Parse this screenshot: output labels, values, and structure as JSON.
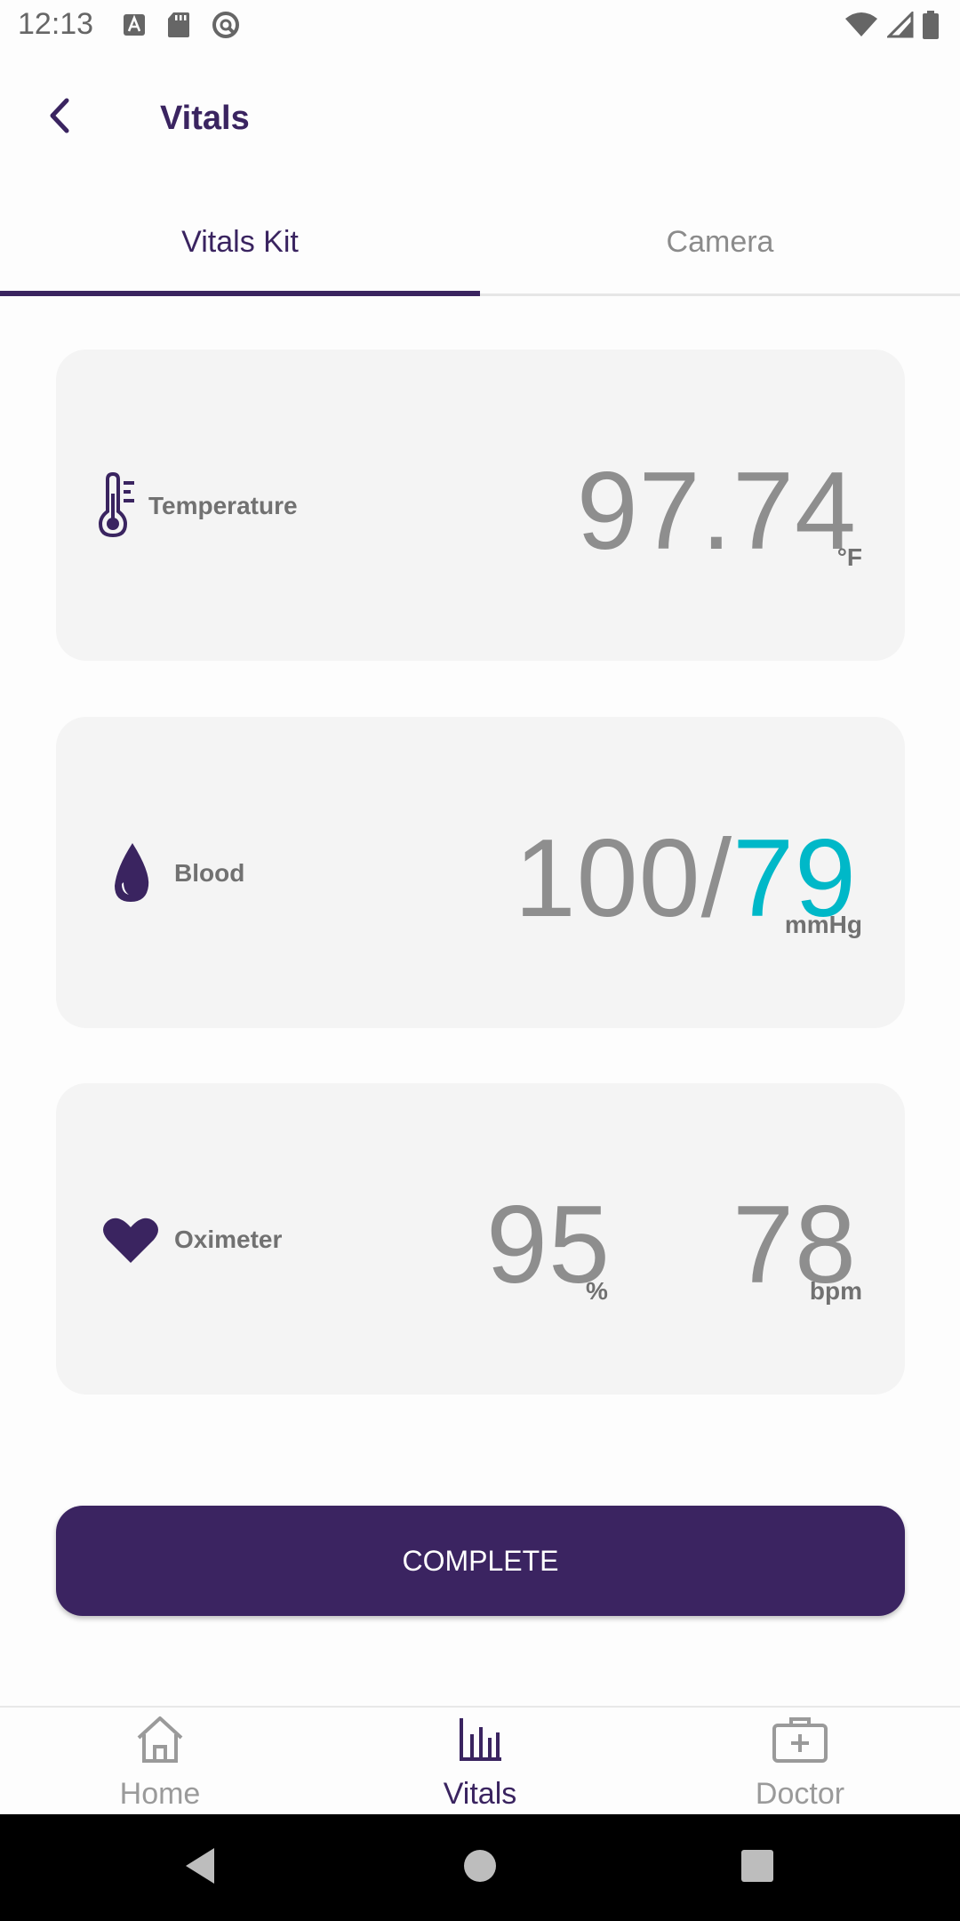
{
  "status_bar": {
    "time": "12:13"
  },
  "app_bar": {
    "title": "Vitals"
  },
  "tabs": [
    {
      "label": "Vitals Kit",
      "selected": true
    },
    {
      "label": "Camera",
      "selected": false
    }
  ],
  "cards": {
    "temperature": {
      "label": "Temperature",
      "value": "97.74",
      "unit": "°F"
    },
    "blood": {
      "label": "Blood",
      "systolic": "100/",
      "diastolic": "79",
      "unit": "mmHg"
    },
    "oximeter": {
      "label": "Oximeter",
      "spo2": "95",
      "spo2_unit": "%",
      "pulse": "78",
      "pulse_unit": "bpm"
    }
  },
  "complete_button": {
    "label": "COMPLETE"
  },
  "bottom_nav": [
    {
      "label": "Home",
      "icon": "home-icon",
      "active": false
    },
    {
      "label": "Vitals",
      "icon": "bar-chart-icon",
      "active": true
    },
    {
      "label": "Doctor",
      "icon": "medical-kit-icon",
      "active": false
    }
  ],
  "colors": {
    "primary": "#3b2461",
    "accent_teal": "#00b8c8",
    "card_bg": "#f4f4f4",
    "value_gray": "#8e8e8e"
  }
}
